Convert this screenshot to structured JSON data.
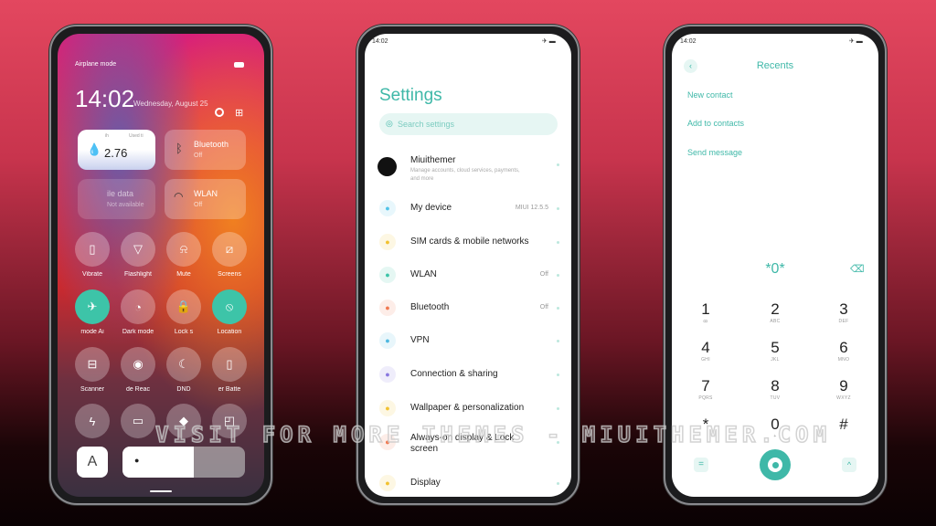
{
  "control_center": {
    "status_text": "Airplane mode",
    "time": "14:02",
    "date": "Wednesday, August 25",
    "data_tile": {
      "value": "2.76",
      "label_left": "ih",
      "label_right": "Used ti"
    },
    "bluetooth_tile": {
      "title": "Bluetooth",
      "status": "Off"
    },
    "mobile_data_tile": {
      "title": "ile data",
      "status": "Not available"
    },
    "wlan_tile": {
      "title": "WLAN",
      "status": "Off"
    },
    "toggles": [
      {
        "label": "Vibrate",
        "icon": "vibrate-icon",
        "glyph": "▯",
        "on": false
      },
      {
        "label": "Flashlight",
        "icon": "flashlight-icon",
        "glyph": "▽",
        "on": false
      },
      {
        "label": "Mute",
        "icon": "bell-off-icon",
        "glyph": "⍾",
        "on": false
      },
      {
        "label": "Screens",
        "icon": "screenshot-icon",
        "glyph": "⧄",
        "on": false
      },
      {
        "label": "mode   Ai",
        "icon": "airplane-icon",
        "glyph": "✈",
        "on": true
      },
      {
        "label": "Dark mode",
        "icon": "dark-mode-icon",
        "glyph": "◔",
        "on": false
      },
      {
        "label": "Lock s",
        "icon": "lock-icon",
        "glyph": "🔒",
        "on": false
      },
      {
        "label": "Location",
        "icon": "location-icon",
        "glyph": "⦸",
        "on": true
      },
      {
        "label": "Scanner",
        "icon": "scanner-icon",
        "glyph": "⊟",
        "on": false
      },
      {
        "label": "de   Reac",
        "icon": "eye-icon",
        "glyph": "◉",
        "on": false
      },
      {
        "label": "DND",
        "icon": "moon-icon",
        "glyph": "☾",
        "on": false
      },
      {
        "label": "er   Batte",
        "icon": "battery-icon",
        "glyph": "▯",
        "on": false
      },
      {
        "label": "",
        "icon": "lightning-icon",
        "glyph": "ϟ",
        "on": false
      },
      {
        "label": "",
        "icon": "cast-icon",
        "glyph": "▭",
        "on": false
      },
      {
        "label": "",
        "icon": "code-icon",
        "glyph": "◆",
        "on": false
      },
      {
        "label": "",
        "icon": "floating-window-icon",
        "glyph": "◰",
        "on": false
      }
    ],
    "auto_brightness_label": "A",
    "brightness_percent": 58
  },
  "settings": {
    "status_time": "14:02",
    "title": "Settings",
    "search_placeholder": "Search settings",
    "account": {
      "name": "Miuithemer",
      "subtitle": "Manage accounts, cloud services, payments, and more"
    },
    "items": [
      {
        "label": "My device",
        "value": "MIUI 12.5.5",
        "icon": "phone-icon",
        "color": "#4fc3e8"
      },
      {
        "label": "SIM cards & mobile networks",
        "value": "",
        "icon": "sim-icon",
        "color": "#f2c230"
      },
      {
        "label": "WLAN",
        "value": "Off",
        "icon": "wifi-icon",
        "color": "#3dc4a8"
      },
      {
        "label": "Bluetooth",
        "value": "Off",
        "icon": "bluetooth-icon",
        "color": "#f07850"
      },
      {
        "label": "VPN",
        "value": "",
        "icon": "vpn-icon",
        "color": "#4fb8e0"
      },
      {
        "label": "Connection & sharing",
        "value": "",
        "icon": "connection-icon",
        "color": "#8a78e0"
      },
      {
        "label": "Wallpaper & personalization",
        "value": "",
        "icon": "wallpaper-icon",
        "color": "#f2c230"
      },
      {
        "label": "Always-on display & Lock screen",
        "value": "",
        "icon": "lock-screen-icon",
        "color": "#f07850"
      },
      {
        "label": "Display",
        "value": "",
        "icon": "display-icon",
        "color": "#f2c230"
      }
    ]
  },
  "dialer": {
    "status_time": "14:02",
    "title": "Recents",
    "actions": [
      "New contact",
      "Add to contacts",
      "Send message"
    ],
    "input": "*0*",
    "keys": [
      {
        "digit": "1",
        "letters": "ꝏ"
      },
      {
        "digit": "2",
        "letters": "ABC"
      },
      {
        "digit": "3",
        "letters": "DEF"
      },
      {
        "digit": "4",
        "letters": "GHI"
      },
      {
        "digit": "5",
        "letters": "JKL"
      },
      {
        "digit": "6",
        "letters": "MNO"
      },
      {
        "digit": "7",
        "letters": "PQRS"
      },
      {
        "digit": "8",
        "letters": "TUV"
      },
      {
        "digit": "9",
        "letters": "WXYZ"
      },
      {
        "digit": "*",
        "letters": ""
      },
      {
        "digit": "0",
        "letters": "+"
      },
      {
        "digit": "#",
        "letters": ""
      }
    ],
    "accent": "#3fb8a8"
  },
  "watermark": "VISIT FOR MORE THEMES - MIUITHEMER.COM"
}
